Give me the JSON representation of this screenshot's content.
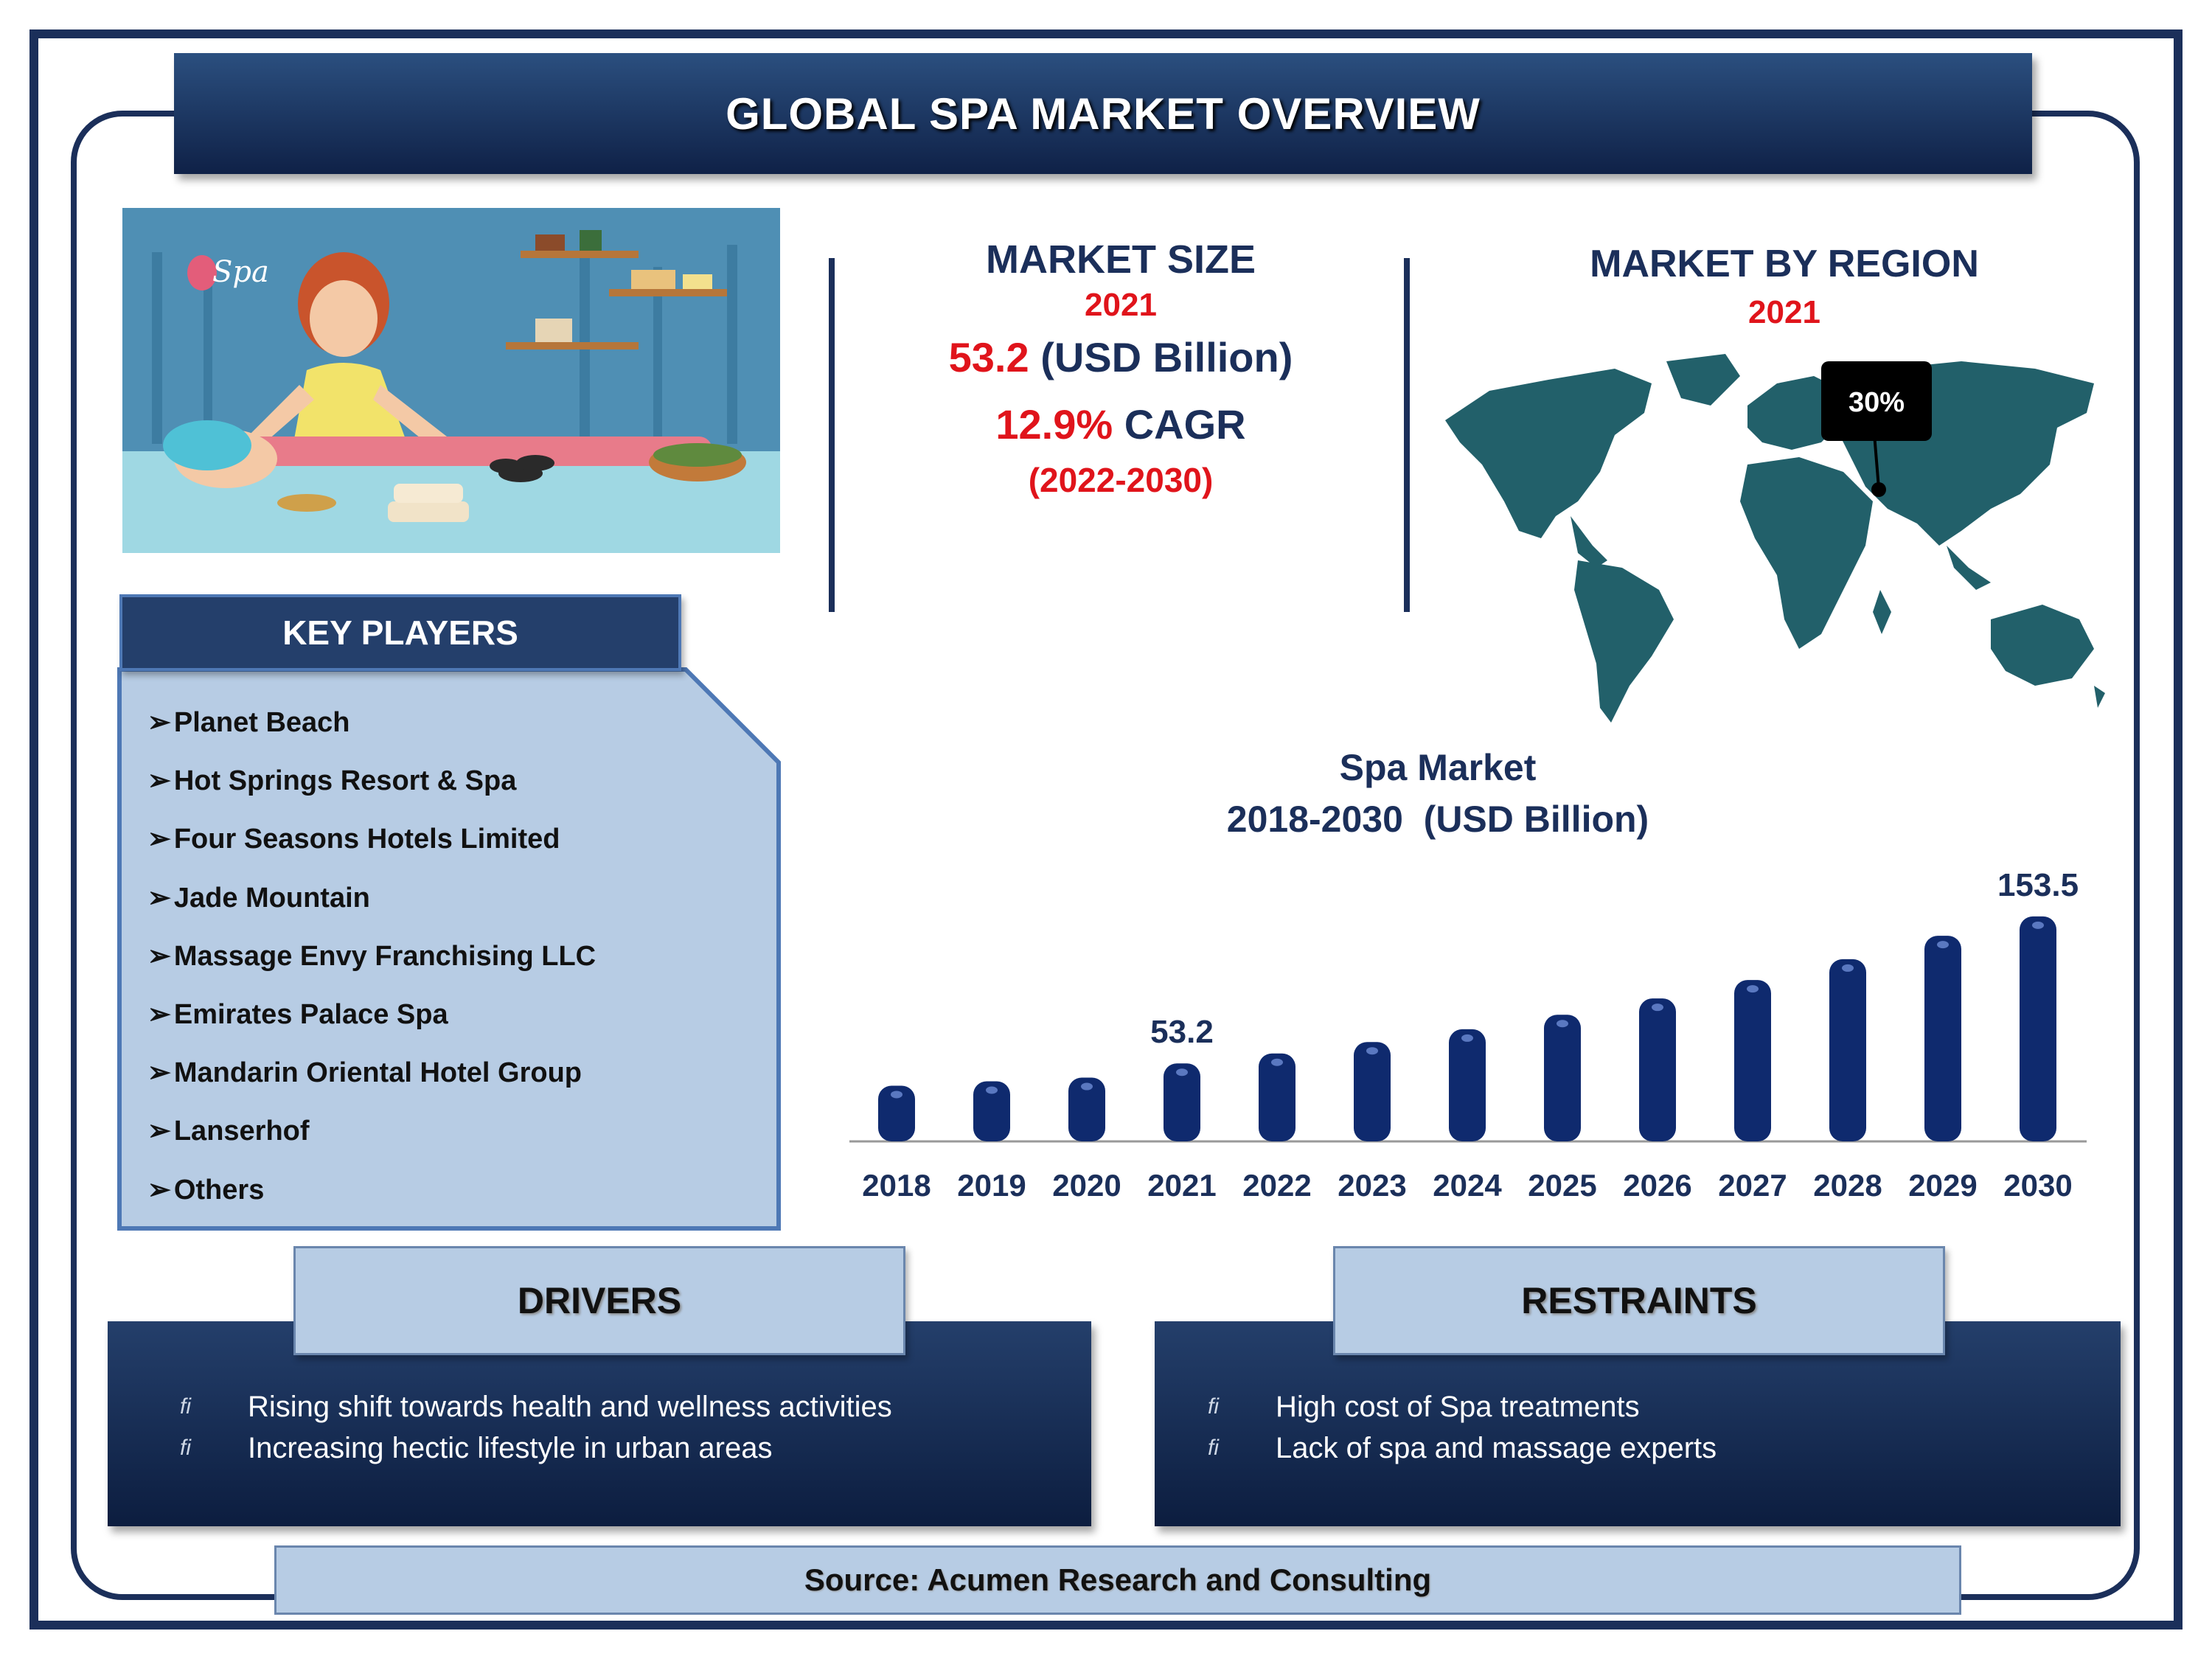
{
  "title": "GLOBAL SPA MARKET OVERVIEW",
  "illustration": {
    "sign_text": "Spa"
  },
  "market_size": {
    "heading": "MARKET SIZE",
    "year": "2021",
    "value": "53.2",
    "unit": "(USD Billion)",
    "cagr_value": "12.9%",
    "cagr_label": "CAGR",
    "cagr_period": "(2022-2030)"
  },
  "market_by_region": {
    "heading": "MARKET BY REGION",
    "year": "2021",
    "share_label": "30%"
  },
  "key_players": {
    "heading": "KEY PLAYERS",
    "items": [
      "Planet Beach",
      "Hot Springs Resort & Spa",
      "Four Seasons Hotels Limited",
      "Jade Mountain",
      "Massage Envy Franchising LLC",
      "Emirates Palace Spa",
      "Mandarin Oriental Hotel Group",
      "Lanserhof",
      "Others"
    ]
  },
  "chart_data": {
    "type": "bar",
    "title": "Spa Market",
    "subtitle": "2018-2030  (USD Billion)",
    "categories": [
      "2018",
      "2019",
      "2020",
      "2021",
      "2022",
      "2023",
      "2024",
      "2025",
      "2026",
      "2027",
      "2028",
      "2029",
      "2030"
    ],
    "values": [
      38.0,
      41.0,
      43.5,
      53.2,
      60.0,
      67.8,
      76.5,
      86.4,
      97.5,
      110.1,
      124.3,
      140.3,
      153.5
    ],
    "data_labels": {
      "2021": "53.2",
      "2030": "153.5"
    },
    "ylim": [
      0,
      165
    ],
    "grid": false,
    "bar_color": "#0f2a6e"
  },
  "drivers": {
    "heading": "DRIVERS",
    "items": [
      "Rising shift towards health and wellness activities",
      "Increasing hectic lifestyle in urban areas"
    ]
  },
  "restraints": {
    "heading": "RESTRAINTS",
    "items": [
      "High cost of Spa treatments",
      "Lack of spa and massage experts"
    ]
  },
  "source": "Source: Acumen Research and Consulting",
  "colors": {
    "navy": "#1b2f5a",
    "accent_red": "#e0141b",
    "map": "#22606a",
    "light_panel": "#b7cce4"
  }
}
